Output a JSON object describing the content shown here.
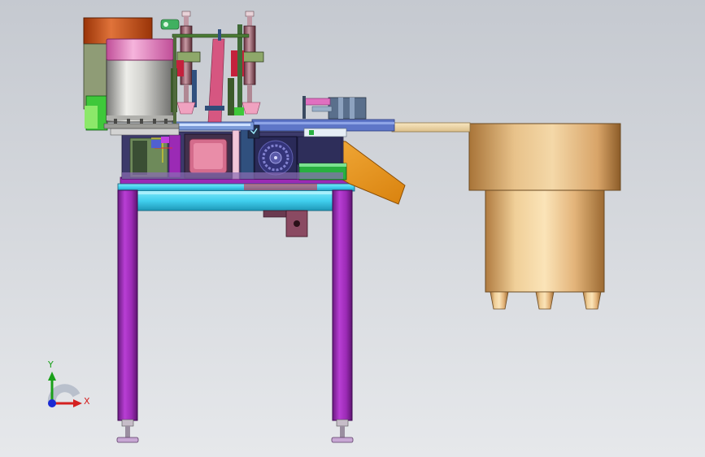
{
  "viewport": {
    "background_top": "#c5c9d0",
    "background_bottom": "#e6e8eb"
  },
  "triad": {
    "y_label": "Y",
    "x_label": "X",
    "y_color": "#1aa01a",
    "x_color": "#d42020",
    "z_color": "#1a2ad4"
  },
  "model": {
    "frame_color": "#9b2ab5",
    "crossbeam_color": "#45d2ee",
    "feeder_bowl_color": "#e0b27a",
    "chute_color": "#f0a020",
    "rail_color": "#f0d8a8",
    "vibration_bowl_color": "#c8c8c4",
    "top_cap_color": "#e890c8",
    "back_drum_color": "#c0501c"
  }
}
